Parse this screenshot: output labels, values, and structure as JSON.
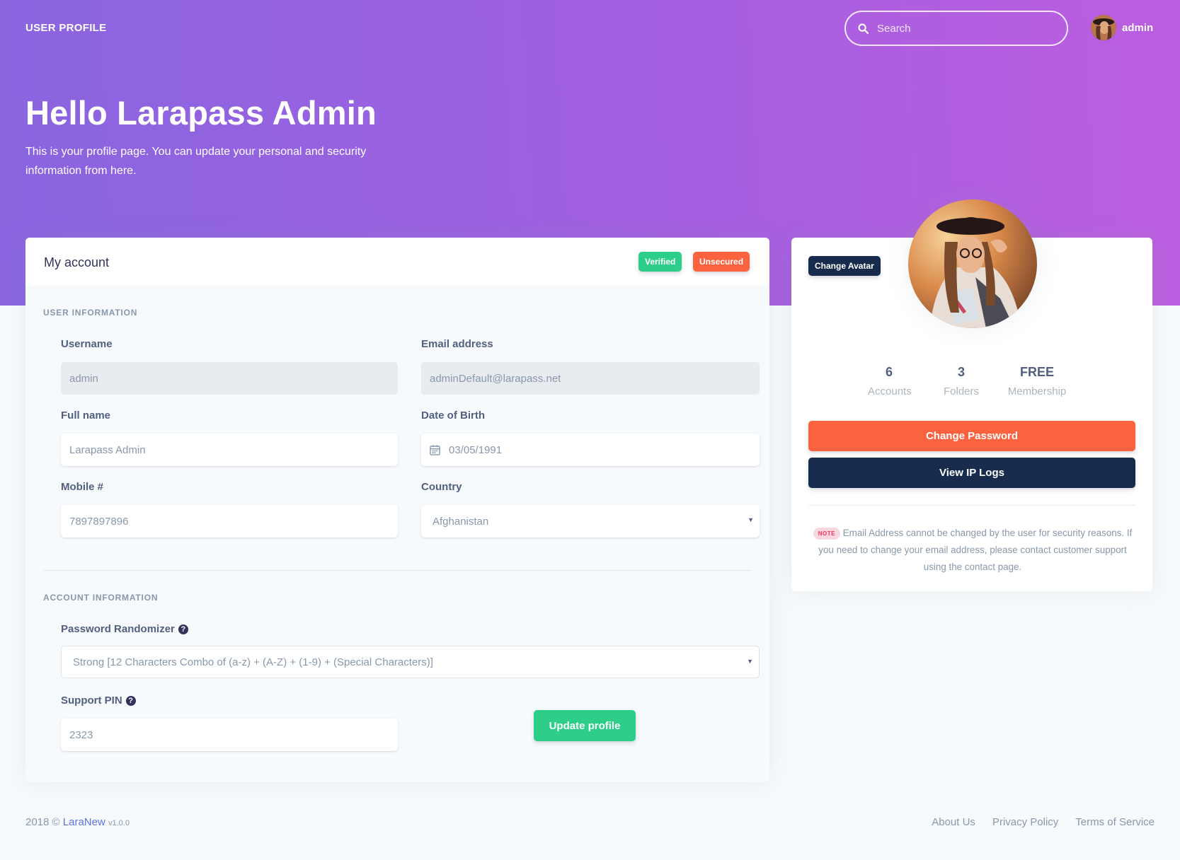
{
  "header": {
    "brand": "USER PROFILE",
    "search_placeholder": "Search",
    "username": "admin"
  },
  "hero": {
    "title": "Hello Larapass Admin",
    "subtitle": "This is your profile page. You can update your personal and security information from here."
  },
  "account": {
    "title": "My account",
    "badges": {
      "verified": "Verified",
      "unsecured": "Unsecured"
    },
    "user_info_label": "USER INFORMATION",
    "fields": {
      "username": {
        "label": "Username",
        "value": "admin"
      },
      "email": {
        "label": "Email address",
        "value": "adminDefault@larapass.net"
      },
      "fullname": {
        "label": "Full name",
        "value": "Larapass Admin"
      },
      "dob": {
        "label": "Date of Birth",
        "value": "03/05/1991"
      },
      "mobile": {
        "label": "Mobile #",
        "value": "7897897896"
      },
      "country": {
        "label": "Country",
        "value": "Afghanistan"
      }
    },
    "account_info_label": "ACCOUNT INFORMATION",
    "password_randomizer": {
      "label": "Password Randomizer",
      "value": "Strong [12 Characters Combo of (a-z) + (A-Z) + (1-9) + (Special Characters)]"
    },
    "support_pin": {
      "label": "Support PIN",
      "value": "2323"
    },
    "update_button": "Update profile"
  },
  "profile_card": {
    "change_avatar": "Change Avatar",
    "stats": [
      {
        "value": "6",
        "label": "Accounts"
      },
      {
        "value": "3",
        "label": "Folders"
      },
      {
        "value": "FREE",
        "label": "Membership"
      }
    ],
    "change_password": "Change Password",
    "view_ip_logs": "View IP Logs",
    "note_badge": "NOTE",
    "note_text": "Email Address cannot be changed by the user for security reasons. If you need to change your email address, please contact customer support using the contact page."
  },
  "footer": {
    "year": "2018 ©",
    "brand": "LaraNew",
    "version": "v1.0.0",
    "links": [
      "About Us",
      "Privacy Policy",
      "Terms of Service"
    ]
  },
  "colors": {
    "hero_gradient_start": "#8965e0",
    "hero_gradient_end": "#bc5ee0",
    "success": "#2dce89",
    "warning": "#fb6340",
    "dark": "#172b4d"
  }
}
